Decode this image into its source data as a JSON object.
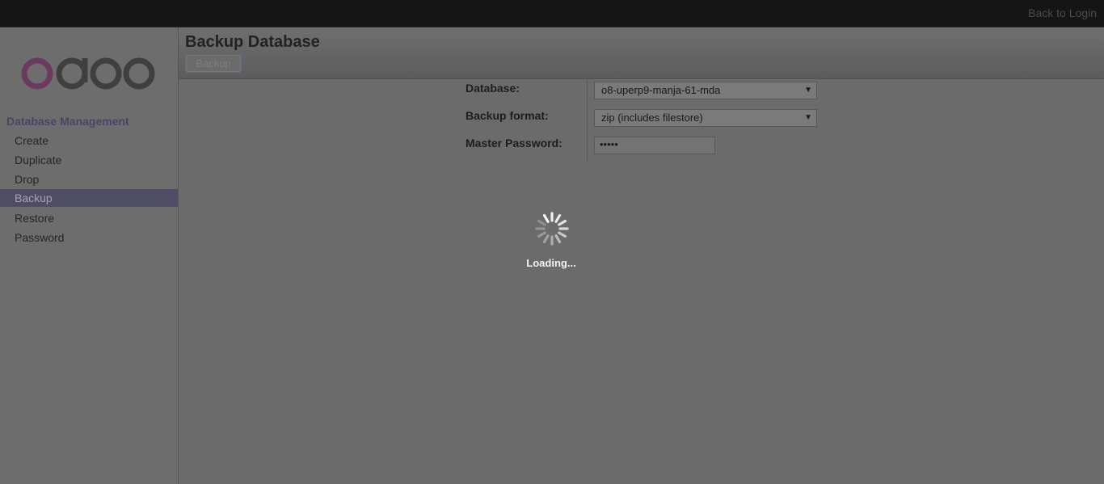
{
  "topbar": {
    "back_to_login": "Back to Login"
  },
  "sidebar": {
    "heading": "Database Management",
    "items": [
      {
        "label": "Create"
      },
      {
        "label": "Duplicate"
      },
      {
        "label": "Drop"
      },
      {
        "label": "Backup",
        "active": true
      },
      {
        "label": "Restore"
      },
      {
        "label": "Password"
      }
    ]
  },
  "header": {
    "title": "Backup Database",
    "backup_button": "Backup"
  },
  "form": {
    "database_label": "Database:",
    "database_value": "o8-uperp9-manja-61-mda",
    "format_label": "Backup format:",
    "format_value": "zip (includes filestore)",
    "password_label": "Master Password:",
    "password_value": "•••••"
  },
  "overlay": {
    "loading_text": "Loading..."
  },
  "colors": {
    "brand_purple": "#6b3a5e",
    "logo_gray": "#3f3f3f",
    "active_item_bg": "#4f4c65"
  }
}
